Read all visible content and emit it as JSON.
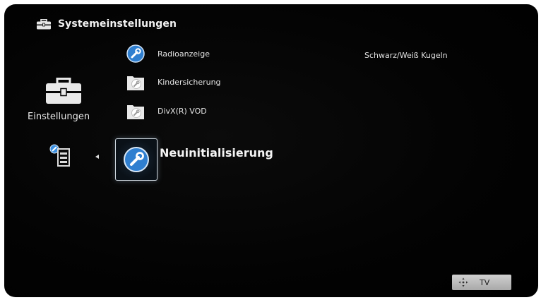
{
  "header": {
    "title": "Systemeinstellungen",
    "icon": "toolbox-icon"
  },
  "category": {
    "label": "Einstellungen",
    "icon": "toolbox-icon"
  },
  "menu": {
    "items": [
      {
        "label": "Radioanzeige",
        "icon": "wrench-icon"
      },
      {
        "label": "Kindersicherung",
        "icon": "folder-wrench-icon"
      },
      {
        "label": "DivX(R) VOD",
        "icon": "folder-wrench-icon"
      }
    ],
    "selected": {
      "label": "Neuinitialisierung",
      "icon": "wrench-icon"
    }
  },
  "description": "Schwarz/Weiß Kugeln",
  "footer": {
    "tv_label": "TV",
    "icon": "dpad-icon"
  },
  "colors": {
    "background": "#000000",
    "accent": "#2f7fd0",
    "text": "#e8e8e8"
  }
}
